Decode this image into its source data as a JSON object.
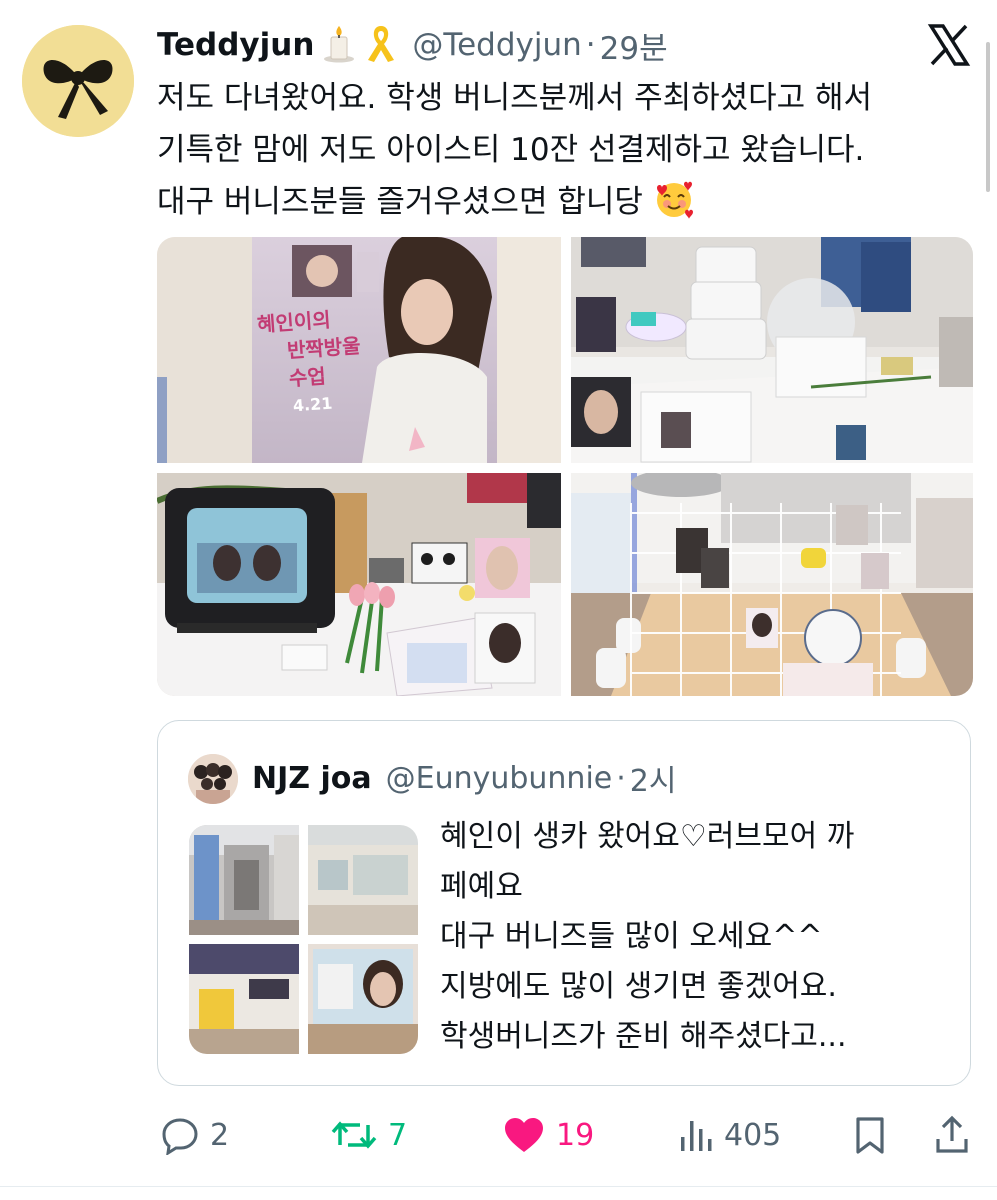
{
  "tweet": {
    "display_name": "Teddyjun",
    "name_emojis": [
      "candle-icon",
      "yellow-ribbon-icon"
    ],
    "handle": "@Teddyjun",
    "separator": "·",
    "time": "29분",
    "text_lines": [
      "저도 다녀왔어요. 학생 버니즈분께서 주최하셨다고 해서",
      "기특한 맘에 저도 아이스티 10잔 선결제하고 왔습니다.",
      "대구 버니즈분들 즐거우셨으면 합니당"
    ],
    "trailing_emoji": "smiling-face-with-hearts-icon",
    "media": [
      {
        "name": "photo-poster",
        "caption": [
          "혜인이의",
          "반짝방울",
          "수업",
          "4.21"
        ]
      },
      {
        "name": "photo-cake-table"
      },
      {
        "name": "photo-tv-flowers"
      },
      {
        "name": "photo-cafe-grid"
      }
    ]
  },
  "quoted": {
    "display_name": "NJZ joa",
    "handle": "@Eunyubunnie",
    "separator": "·",
    "time": "2시",
    "text_lines": [
      "혜인이 생카 왔어요♡러브모어 까",
      "페예요",
      "대구 버니즈들 많이 오세요^^",
      "지방에도 많이 생기면 좋겠어요.",
      "학생버니즈가 준비 해주셨다고..."
    ]
  },
  "actions": {
    "replies": "2",
    "reposts": "7",
    "likes": "19",
    "views": "405"
  },
  "colors": {
    "text": "#0f1419",
    "secondary": "#536471",
    "repost": "#00ba7c",
    "like": "#f91880",
    "border": "#cfd9de"
  }
}
